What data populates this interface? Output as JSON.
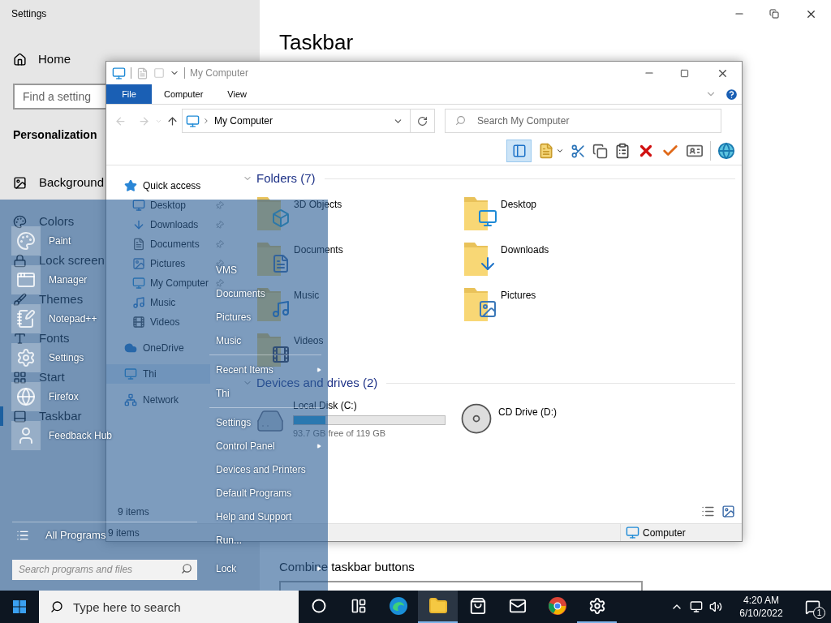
{
  "settings": {
    "title": "Settings",
    "home": "Home",
    "search": {
      "placeholder": "Find a setting"
    },
    "section": "Personalization",
    "nav": [
      {
        "label": "Background",
        "selected": false
      },
      {
        "label": "Colors",
        "selected": false
      },
      {
        "label": "Lock screen",
        "selected": false
      },
      {
        "label": "Themes",
        "selected": false
      },
      {
        "label": "Fonts",
        "selected": false
      },
      {
        "label": "Start",
        "selected": false
      },
      {
        "label": "Taskbar",
        "selected": true
      }
    ],
    "page_title": "Taskbar",
    "combine_label": "Combine taskbar buttons"
  },
  "explorer": {
    "title": "My Computer",
    "ribbon_tabs": [
      {
        "label": "File",
        "selected": true
      },
      {
        "label": "Computer",
        "selected": false
      },
      {
        "label": "View",
        "selected": false
      }
    ],
    "address": "My Computer",
    "search": {
      "placeholder": "Search My Computer"
    },
    "nav": [
      {
        "label": "Quick access",
        "selected": false,
        "children": [
          {
            "label": "Desktop",
            "pinned": true,
            "selected": false
          },
          {
            "label": "Downloads",
            "pinned": true,
            "selected": false
          },
          {
            "label": "Documents",
            "pinned": true,
            "selected": false
          },
          {
            "label": "Pictures",
            "pinned": true,
            "selected": false
          },
          {
            "label": "My Computer",
            "pinned": true,
            "selected": false
          },
          {
            "label": "Music",
            "pinned": false,
            "selected": false
          },
          {
            "label": "Videos",
            "pinned": false,
            "selected": false
          }
        ]
      },
      {
        "label": "OneDrive",
        "selected": false
      },
      {
        "label": "Thi",
        "selected": true
      },
      {
        "label": "Network",
        "selected": false
      }
    ],
    "pane_count": "9 items",
    "folders_heading": "Folders (7)",
    "folders": [
      {
        "name": "3D Objects"
      },
      {
        "name": "Desktop"
      },
      {
        "name": "Documents"
      },
      {
        "name": "Downloads"
      },
      {
        "name": "Music"
      },
      {
        "name": "Pictures"
      },
      {
        "name": "Videos"
      }
    ],
    "drives_heading": "Devices and drives (2)",
    "drives": [
      {
        "kind": "disk",
        "name": "Local Disk (C:)",
        "free": "93.7 GB free of 119 GB",
        "level": 0.21
      },
      {
        "kind": "optical",
        "name": "CD Drive (D:)"
      }
    ],
    "status_count": "9 items",
    "status_location": "Computer"
  },
  "start_menu": {
    "programs": [
      {
        "name": "Paint"
      },
      {
        "name": "Manager"
      },
      {
        "name": "Notepad++"
      },
      {
        "name": "Settings"
      },
      {
        "name": "Firefox"
      },
      {
        "name": "Feedback Hub"
      }
    ],
    "places": [
      [
        {
          "label": "VMS",
          "submenu": false
        },
        {
          "label": "Documents",
          "submenu": false
        },
        {
          "label": "Pictures",
          "submenu": false
        },
        {
          "label": "Music",
          "submenu": false
        }
      ],
      [
        {
          "label": "Recent Items",
          "submenu": true
        },
        {
          "label": "Thi",
          "submenu": false
        }
      ],
      [
        {
          "label": "Settings",
          "submenu": false
        },
        {
          "label": "Control Panel",
          "submenu": true
        },
        {
          "label": "Devices and Printers",
          "submenu": false
        },
        {
          "label": "Default Programs",
          "submenu": false
        },
        {
          "label": "Help and Support",
          "submenu": false
        },
        {
          "label": "Run...",
          "submenu": false
        }
      ]
    ],
    "lock": {
      "label": "Lock",
      "submenu": true
    },
    "all_programs": "All Programs",
    "search": {
      "placeholder": "Search programs and files"
    }
  },
  "taskbar": {
    "search": {
      "placeholder": "Type here to search"
    },
    "apps": [
      {
        "kind": "cortana",
        "running": false,
        "active": false
      },
      {
        "kind": "taskview",
        "running": false,
        "active": false
      },
      {
        "kind": "edge",
        "running": false,
        "active": false
      },
      {
        "kind": "explorer",
        "running": true,
        "active": true
      },
      {
        "kind": "store",
        "running": false,
        "active": false
      },
      {
        "kind": "mail",
        "running": false,
        "active": false
      },
      {
        "kind": "chrome",
        "running": false,
        "active": false
      },
      {
        "kind": "settings",
        "running": true,
        "active": false
      }
    ],
    "time": "4:20 AM",
    "date": "6/10/2022",
    "notifications": "1"
  }
}
